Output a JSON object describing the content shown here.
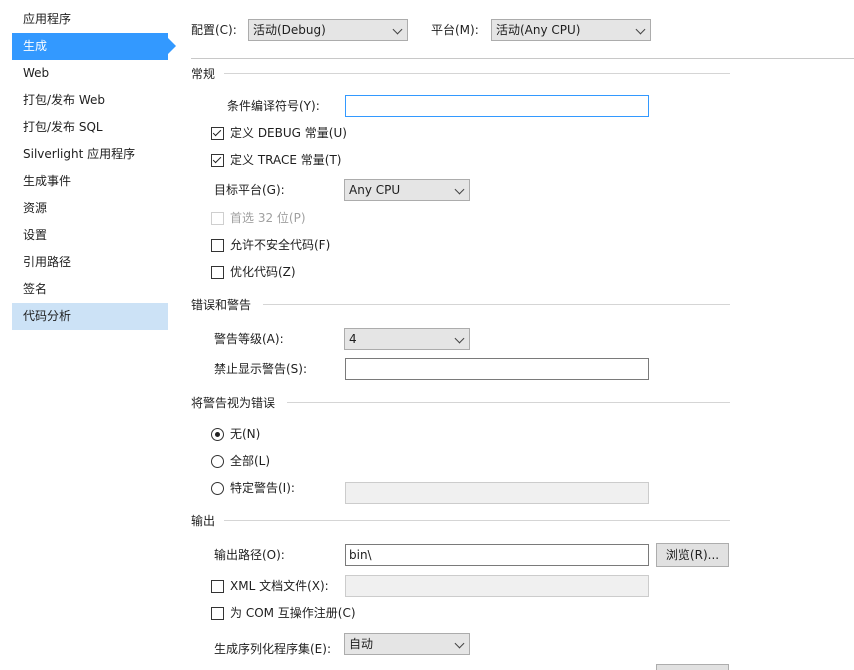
{
  "sidebar": {
    "items": [
      {
        "label": "应用程序"
      },
      {
        "label": "生成"
      },
      {
        "label": "Web"
      },
      {
        "label": "打包/发布 Web"
      },
      {
        "label": "打包/发布 SQL"
      },
      {
        "label": "Silverlight 应用程序"
      },
      {
        "label": "生成事件"
      },
      {
        "label": "资源"
      },
      {
        "label": "设置"
      },
      {
        "label": "引用路径"
      },
      {
        "label": "签名"
      },
      {
        "label": "代码分析"
      }
    ],
    "selected": "生成"
  },
  "top": {
    "config_label": "配置(C):",
    "config_value": "活动(Debug)",
    "platform_label": "平台(M):",
    "platform_value": "活动(Any CPU)"
  },
  "general": {
    "title": "常规",
    "conditional_symbols_label": "条件编译符号(Y):",
    "conditional_symbols_value": "",
    "define_debug_label": "定义 DEBUG 常量(U)",
    "define_debug_checked": true,
    "define_trace_label": "定义 TRACE 常量(T)",
    "define_trace_checked": true,
    "target_platform_label": "目标平台(G):",
    "target_platform_value": "Any CPU",
    "prefer32_label": "首选 32 位(P)",
    "prefer32_checked": false,
    "unsafe_label": "允许不安全代码(F)",
    "unsafe_checked": false,
    "optimize_label": "优化代码(Z)",
    "optimize_checked": false
  },
  "errors": {
    "title": "错误和警告",
    "warning_level_label": "警告等级(A):",
    "warning_level_value": "4",
    "suppress_label": "禁止显示警告(S):",
    "suppress_value": ""
  },
  "treat_warnings": {
    "title": "将警告视为错误",
    "none_label": "无(N)",
    "all_label": "全部(L)",
    "specific_label": "特定警告(I):",
    "selected": "none",
    "specific_value": ""
  },
  "output": {
    "title": "输出",
    "path_label": "输出路径(O):",
    "path_value": "bin\\",
    "browse_label": "浏览(R)...",
    "xml_doc_label": "XML 文档文件(X):",
    "xml_doc_checked": false,
    "xml_doc_value": "",
    "com_label": "为 COM 互操作注册(C)",
    "com_checked": false,
    "serialization_label": "生成序列化程序集(E):",
    "serialization_value": "自动"
  }
}
